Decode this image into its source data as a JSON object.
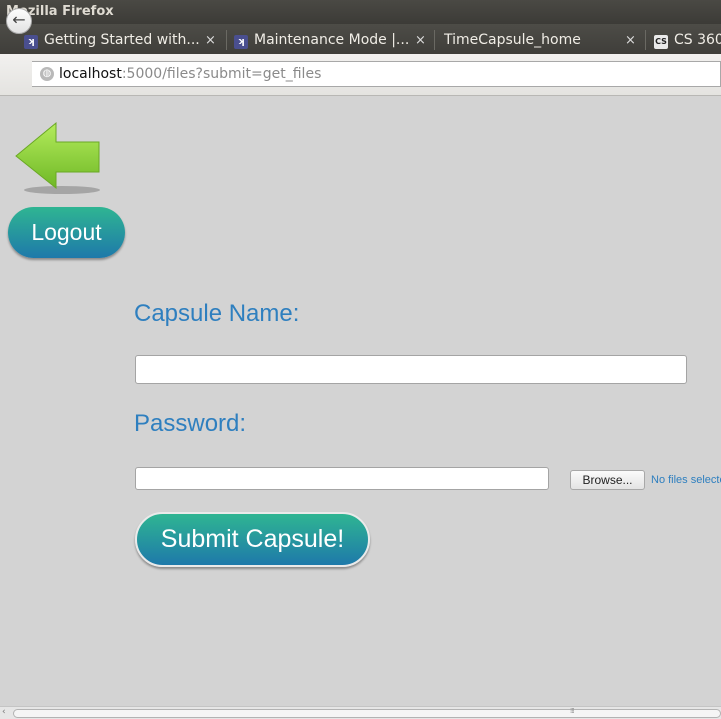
{
  "window": {
    "title": "Mozilla Firefox"
  },
  "tabs": [
    {
      "title": "Getting Started with...",
      "favicon": "ix-favicon-icon",
      "close": "×"
    },
    {
      "title": "Maintenance Mode |...",
      "favicon": "ix-favicon-icon",
      "close": "×"
    },
    {
      "title": "TimeCapsule_home",
      "favicon": "",
      "close": "×"
    },
    {
      "title": "CS 360",
      "favicon": "cs-favicon-icon"
    }
  ],
  "tab_favicon_glyphs": {
    "ix": "ʞ",
    "cs": "CS"
  },
  "nav": {
    "back_glyph": "←",
    "url_host": "localhost",
    "url_rest": ":5000/files?submit=get_files"
  },
  "page": {
    "logout_label": "Logout",
    "capsule_name_label": "Capsule Name:",
    "capsule_name_value": "",
    "password_label": "Password:",
    "password_value": "",
    "browse_label": "Browse...",
    "file_status": "No files selected.",
    "submit_label": "Submit Capsule!"
  },
  "colors": {
    "page_background": "#d3d3d3",
    "label_text": "#2e7fbf",
    "button_gradient_top": "#2fb592",
    "button_gradient_bottom": "#1e79aa",
    "back_arrow_green": "#8fd13d"
  }
}
